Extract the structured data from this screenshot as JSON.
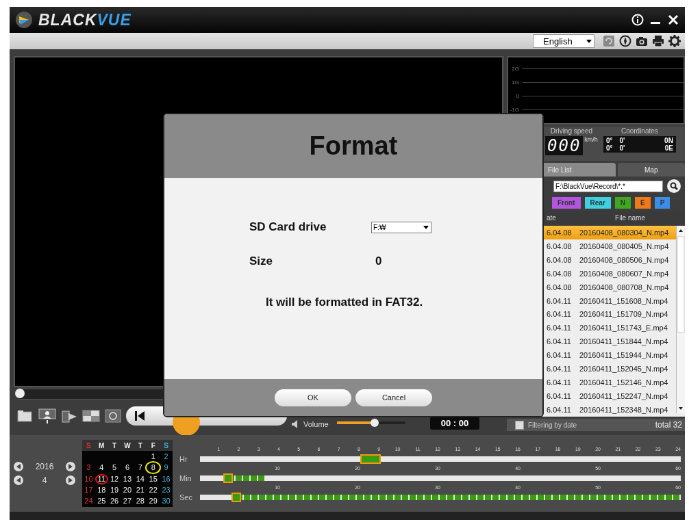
{
  "title_bar": {
    "logo": [
      "BLACK",
      "VUE"
    ]
  },
  "toolbar": {
    "language": "English"
  },
  "player": {
    "seek": {
      "level": 0
    },
    "volume": {
      "label": "Volume",
      "level": 0.55
    },
    "time": "00 : 00"
  },
  "g_sensor": {
    "labels": [
      "2G",
      "1G",
      "0",
      "-1G"
    ]
  },
  "speed": {
    "label": "Driving speed",
    "digits": "000",
    "unit": "km/h"
  },
  "coordinates": {
    "label": "Coordinates",
    "rows": [
      {
        "deg": "0°",
        "min": "0'",
        "dir": "0N"
      },
      {
        "deg": "0°",
        "min": "0'",
        "dir": "0E"
      }
    ]
  },
  "tabs": [
    {
      "label": "File List",
      "selected": true
    },
    {
      "label": "Map",
      "selected": false
    }
  ],
  "path": "F:\\BlackVue\\Record\\*.*",
  "filters": [
    {
      "label": "Front",
      "color": "#b455e0"
    },
    {
      "label": "Rear",
      "color": "#3fd0e0"
    },
    {
      "label": "N",
      "color": "#3ea81e"
    },
    {
      "label": "E",
      "color": "#f07a1a"
    },
    {
      "label": "P",
      "color": "#3a8ee8"
    }
  ],
  "columns": [
    "ate",
    "File name"
  ],
  "rows": [
    {
      "date": "6.04.08",
      "file": "20160408_080304_N.mp4",
      "selected": true
    },
    {
      "date": "6.04.08",
      "file": "20160408_080405_N.mp4",
      "selected": false
    },
    {
      "date": "6.04.08",
      "file": "20160408_080506_N.mp4",
      "selected": false
    },
    {
      "date": "6.04.08",
      "file": "20160408_080607_N.mp4",
      "selected": false
    },
    {
      "date": "6.04.08",
      "file": "20160408_080708_N.mp4",
      "selected": false
    },
    {
      "date": "6.04.11",
      "file": "20160411_151608_N.mp4",
      "selected": false
    },
    {
      "date": "6.04.11",
      "file": "20160411_151709_N.mp4",
      "selected": false
    },
    {
      "date": "6.04.11",
      "file": "20160411_151743_E.mp4",
      "selected": false
    },
    {
      "date": "6.04.11",
      "file": "20160411_151844_N.mp4",
      "selected": false
    },
    {
      "date": "6.04.11",
      "file": "20160411_151944_N.mp4",
      "selected": false
    },
    {
      "date": "6.04.11",
      "file": "20160411_152045_N.mp4",
      "selected": false
    },
    {
      "date": "6.04.11",
      "file": "20160411_152146_N.mp4",
      "selected": false
    },
    {
      "date": "6.04.11",
      "file": "20160411_152247_N.mp4",
      "selected": false
    },
    {
      "date": "6.04.11",
      "file": "20160411_152348_N.mp4",
      "selected": false
    }
  ],
  "filter_by_date": {
    "label": "Filtering by date",
    "checked": false
  },
  "total": "total 32",
  "date_nav": {
    "year": "2016",
    "month": "4"
  },
  "calendar": {
    "weekdays": [
      "S",
      "M",
      "T",
      "W",
      "T",
      "F",
      "S"
    ],
    "days": [
      {
        "label": "1",
        "selected": false,
        "marked": false
      },
      {
        "label": "2",
        "selected": false,
        "marked": false
      },
      {
        "label": "3",
        "selected": false,
        "marked": false
      },
      {
        "label": "4",
        "selected": false,
        "marked": false
      },
      {
        "label": "5",
        "selected": false,
        "marked": false
      },
      {
        "label": "6",
        "selected": false,
        "marked": false
      },
      {
        "label": "7",
        "selected": false,
        "marked": false
      },
      {
        "label": "8",
        "selected": false,
        "marked": true
      },
      {
        "label": "9",
        "selected": false,
        "marked": false
      },
      {
        "label": "10",
        "selected": false,
        "marked": false
      },
      {
        "label": "11",
        "selected": true,
        "marked": false
      },
      {
        "label": "12",
        "selected": false,
        "marked": false
      },
      {
        "label": "13",
        "selected": false,
        "marked": false
      },
      {
        "label": "14",
        "selected": false,
        "marked": false
      },
      {
        "label": "15",
        "selected": false,
        "marked": false
      },
      {
        "label": "16",
        "selected": false,
        "marked": false
      },
      {
        "label": "17",
        "selected": false,
        "marked": false
      },
      {
        "label": "18",
        "selected": false,
        "marked": false
      },
      {
        "label": "19",
        "selected": false,
        "marked": false
      },
      {
        "label": "20",
        "selected": false,
        "marked": false
      },
      {
        "label": "21",
        "selected": false,
        "marked": false
      },
      {
        "label": "22",
        "selected": false,
        "marked": false
      },
      {
        "label": "23",
        "selected": false,
        "marked": false
      },
      {
        "label": "24",
        "selected": false,
        "marked": false
      },
      {
        "label": "25",
        "selected": false,
        "marked": false
      },
      {
        "label": "26",
        "selected": false,
        "marked": false
      },
      {
        "label": "27",
        "selected": false,
        "marked": false
      },
      {
        "label": "28",
        "selected": false,
        "marked": false
      },
      {
        "label": "29",
        "selected": false,
        "marked": false
      },
      {
        "label": "30",
        "selected": false,
        "marked": false
      }
    ]
  },
  "timeline": [
    {
      "kind": "hour",
      "label": "Hr",
      "ticks": [
        "1",
        "2",
        "3",
        "4",
        "5",
        "6",
        "7",
        "8",
        "9",
        "10",
        "11",
        "12",
        "13",
        "14",
        "15",
        "16",
        "17",
        "18",
        "19",
        "20",
        "21",
        "22",
        "23",
        "24"
      ],
      "level": 0.354
    },
    {
      "kind": "minute",
      "label": "Min",
      "ticks": [
        "10",
        "20",
        "30",
        "40",
        "50",
        "60"
      ],
      "level": 0.058
    },
    {
      "kind": "second",
      "label": "Sec",
      "ticks": [
        "10",
        "20",
        "30",
        "40",
        "50",
        "60"
      ],
      "level": 0.075
    }
  ],
  "dialog": {
    "title": "Format",
    "fields": [
      {
        "kind": "select",
        "label": "SD Card drive",
        "value": "F:₩"
      },
      {
        "kind": "text",
        "label": "Size",
        "value": "0"
      }
    ],
    "message": "It will be formatted in FAT32.",
    "buttons": [
      "OK",
      "Cancel"
    ]
  }
}
